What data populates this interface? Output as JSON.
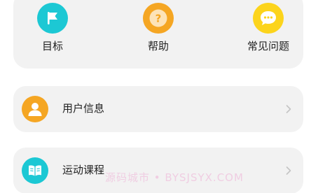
{
  "shortcuts": [
    {
      "label": "目标",
      "icon": "flag-icon",
      "color": "#1cc8d4"
    },
    {
      "label": "帮助",
      "icon": "question-icon",
      "color": "#f5a623"
    },
    {
      "label": "常见问题",
      "icon": "chat-bubble-icon",
      "color": "#fcd41c"
    }
  ],
  "list": [
    {
      "label": "用户信息",
      "icon": "user-icon",
      "color": "#f5a623"
    },
    {
      "label": "运动课程",
      "icon": "book-icon",
      "color": "#1cc8d4"
    }
  ],
  "watermark": "源码城市 • BYSJSYX.COM",
  "colors": {
    "card_bg": "#f2f2f2",
    "chevron": "#c4c4c4",
    "text": "#222222"
  }
}
